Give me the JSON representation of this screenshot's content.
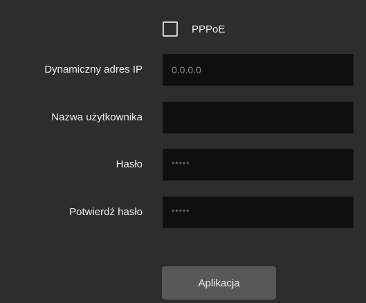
{
  "pppoe": {
    "label": "PPPoE",
    "checked": false
  },
  "fields": {
    "dynamic_ip": {
      "label": "Dynamiczny adres IP",
      "value": "0.0.0.0"
    },
    "username": {
      "label": "Nazwa użytkownika",
      "value": ""
    },
    "password": {
      "label": "Hasło",
      "value": "*****"
    },
    "confirm_password": {
      "label": "Potwierdź hasło",
      "value": "*****"
    }
  },
  "apply_button": {
    "label": "Aplikacja"
  }
}
